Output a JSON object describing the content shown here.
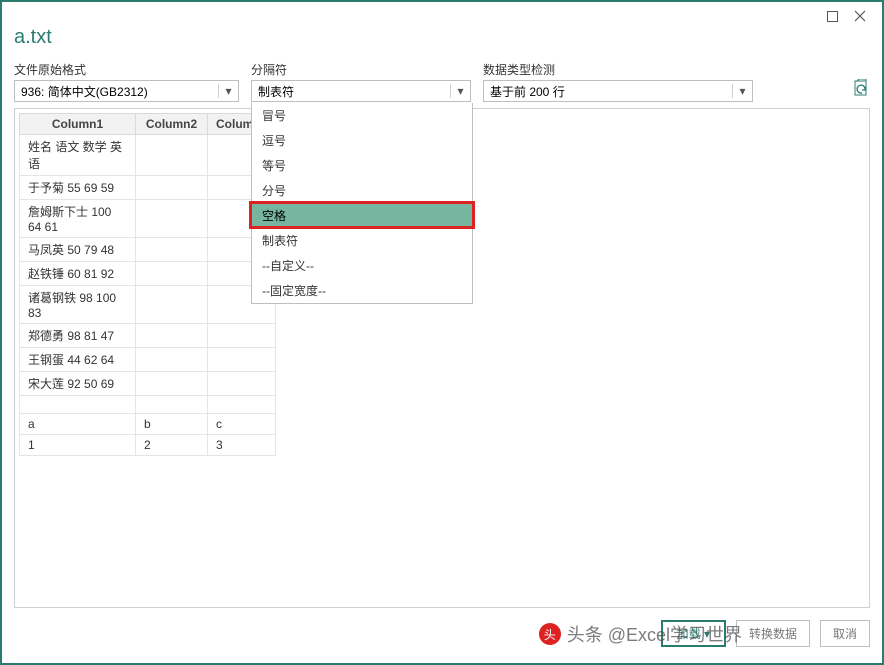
{
  "window": {
    "title": "a.txt"
  },
  "controls": {
    "file_origin": {
      "label": "文件原始格式",
      "value": "936: 简体中文(GB2312)"
    },
    "delimiter": {
      "label": "分隔符",
      "value": "制表符",
      "options": [
        "冒号",
        "逗号",
        "等号",
        "分号",
        "空格",
        "制表符",
        "--自定义--",
        "--固定宽度--"
      ],
      "highlighted": "空格"
    },
    "detection": {
      "label": "数据类型检测",
      "value": "基于前 200 行"
    }
  },
  "preview": {
    "headers": [
      "Column1",
      "Column2",
      "Column3"
    ],
    "rows": [
      [
        "姓名 语文 数学 英语",
        "",
        ""
      ],
      [
        "于予菊 55 69 59",
        "",
        ""
      ],
      [
        "詹姆斯下士 100 64 61",
        "",
        ""
      ],
      [
        "马凤英 50 79 48",
        "",
        ""
      ],
      [
        "赵铁锤 60 81 92",
        "",
        ""
      ],
      [
        "诸葛钢铁 98 100 83",
        "",
        ""
      ],
      [
        "郑德勇 98 81 47",
        "",
        ""
      ],
      [
        "王钢蛋 44 62 64",
        "",
        ""
      ],
      [
        "宋大莲 92 50 69",
        "",
        ""
      ]
    ],
    "footer_rows": [
      [
        "a",
        "b",
        "c"
      ],
      [
        "1",
        "2",
        "3"
      ]
    ]
  },
  "buttons": {
    "load": "加载",
    "transform": "转换数据",
    "cancel": "取消"
  },
  "watermark": "头条 @Excel学习世界"
}
